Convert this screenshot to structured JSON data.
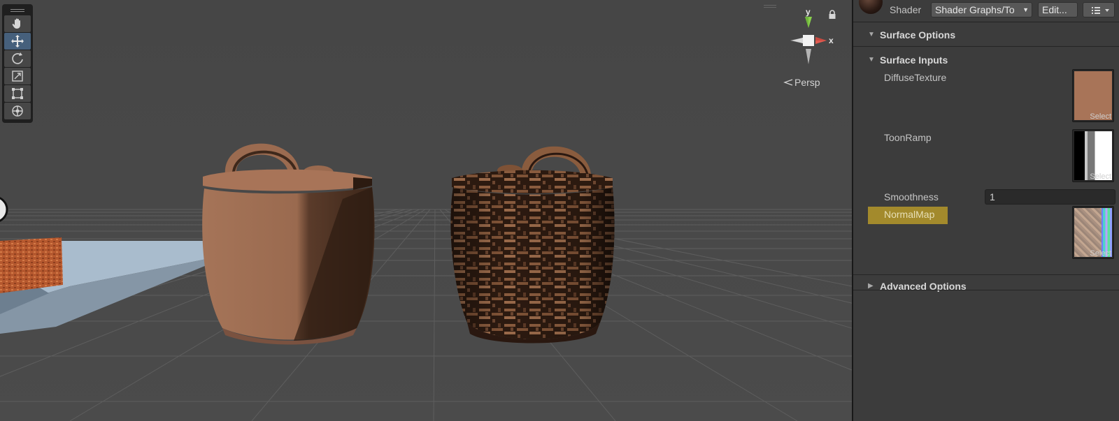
{
  "scene": {
    "tools": [
      {
        "name": "hand-tool",
        "active": false
      },
      {
        "name": "move-tool",
        "active": true
      },
      {
        "name": "rotate-tool",
        "active": false
      },
      {
        "name": "scale-tool",
        "active": false
      },
      {
        "name": "rect-tool",
        "active": false
      },
      {
        "name": "transform-tool",
        "active": false
      }
    ],
    "gizmo": {
      "y_label": "y",
      "x_label": "x"
    },
    "projection_label": "Persp"
  },
  "inspector": {
    "shader_label": "Shader",
    "shader_value": "Shader Graphs/To",
    "edit_label": "Edit...",
    "sections": {
      "surface_options": "Surface Options",
      "surface_inputs": "Surface Inputs",
      "advanced_options": "Advanced Options"
    },
    "properties": {
      "diffuse_label": "DiffuseTexture",
      "toon_label": "ToonRamp",
      "smoothness_label": "Smoothness",
      "smoothness_value": "1",
      "normal_label": "NormalMap",
      "select_label": "Select"
    },
    "colors": {
      "diffuse_swatch": "#a87458",
      "highlight": "#a38a2c",
      "active_tool": "#46607c"
    }
  }
}
